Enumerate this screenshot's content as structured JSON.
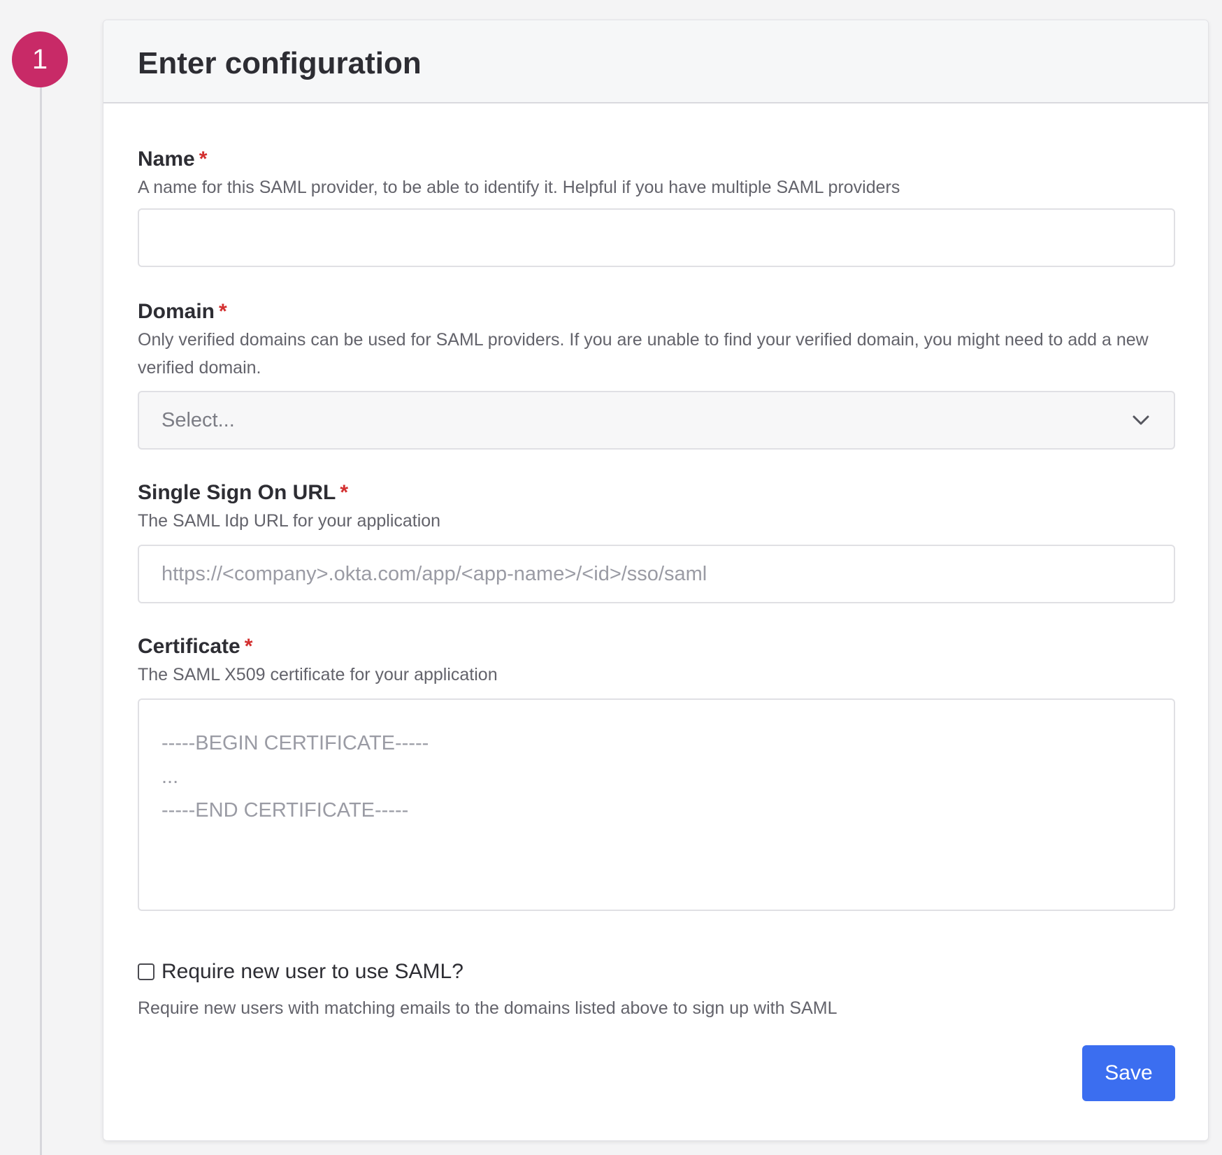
{
  "step": {
    "number": "1"
  },
  "card": {
    "title": "Enter configuration"
  },
  "fields": {
    "name": {
      "label": "Name",
      "required_mark": "*",
      "description": "A name for this SAML provider, to be able to identify it. Helpful if you have multiple SAML providers",
      "value": ""
    },
    "domain": {
      "label": "Domain",
      "required_mark": "*",
      "description": "Only verified domains can be used for SAML providers. If you are unable to find your verified domain, you might need to add a new verified domain.",
      "placeholder": "Select...",
      "icon": "chevron-down-icon"
    },
    "sso_url": {
      "label": "Single Sign On URL",
      "required_mark": "*",
      "description": "The SAML Idp URL for your application",
      "placeholder": "https://<company>.okta.com/app/<app-name>/<id>/sso/saml",
      "value": ""
    },
    "certificate": {
      "label": "Certificate",
      "required_mark": "*",
      "description": "The SAML X509 certificate for your application",
      "placeholder_lines": [
        "-----BEGIN CERTIFICATE-----",
        "...",
        "-----END CERTIFICATE-----"
      ]
    }
  },
  "require_saml": {
    "label": "Require new user to use SAML?",
    "description": "Require new users with matching emails to the domains listed above to sign up with SAML",
    "checked": false
  },
  "actions": {
    "save_label": "Save"
  },
  "colors": {
    "step_badge": "#c82a67",
    "required": "#d32f2f",
    "primary_button": "#3b6ef0"
  }
}
